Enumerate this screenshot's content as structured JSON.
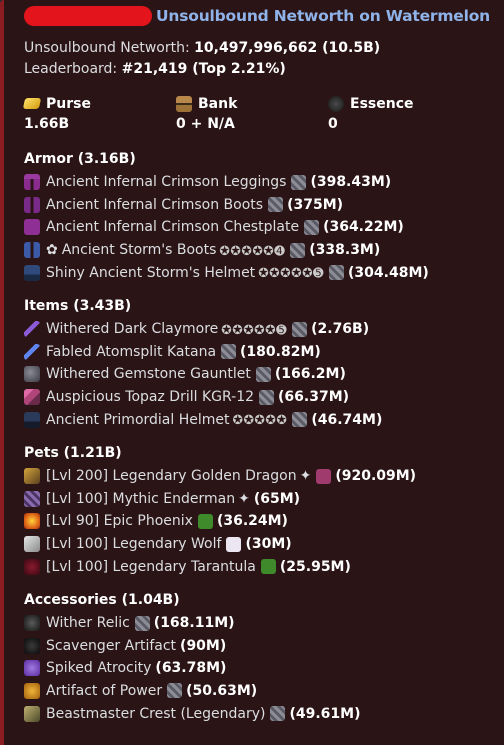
{
  "header": {
    "title": "Unsoulbound Networth on Watermelon"
  },
  "summary": {
    "networth_label": "Unsoulbound Networth:",
    "networth_value": "10,497,996,662 (10.5B)",
    "leaderboard_label": "Leaderboard:",
    "leaderboard_value": "#21,419 (Top 2.21%)"
  },
  "fields": [
    {
      "name": "Purse",
      "value": "1.66B",
      "icon": "gold-ingot-icon",
      "color": "#f5c518"
    },
    {
      "name": "Bank",
      "value": "0 + N/A",
      "icon": "chest-icon",
      "color": "#a07a44"
    },
    {
      "name": "Essence",
      "value": "0",
      "icon": "wither-essence-icon",
      "color": "#3a3a3a"
    }
  ],
  "sections": [
    {
      "title": "Armor (3.16B)",
      "items": [
        {
          "name": "Ancient Infernal Crimson Leggings",
          "value": "(398.43M)",
          "icon": "leggings-icon",
          "color": "#8a2b8f",
          "prefix": "",
          "stars": "",
          "glyph": ""
        },
        {
          "name": "Ancient Infernal Crimson Boots",
          "value": "(375M)",
          "icon": "boots-icon",
          "color": "#7a2a88",
          "prefix": "",
          "stars": "",
          "glyph": ""
        },
        {
          "name": "Ancient Infernal Crimson Chestplate",
          "value": "(364.22M)",
          "icon": "chestplate-icon",
          "color": "#8e2f96",
          "prefix": "",
          "stars": "",
          "glyph": ""
        },
        {
          "name": "Ancient Storm's Boots",
          "value": "(338.3M)",
          "icon": "storm-boots-icon",
          "color": "#3b5aa8",
          "prefix": "✿",
          "stars": "✪✪✪✪✪➍",
          "glyph": ""
        },
        {
          "name": "Shiny Ancient Storm's Helmet",
          "value": "(304.48M)",
          "icon": "storm-helmet-icon",
          "color": "#2f4a7a",
          "prefix": "",
          "stars": "✪✪✪✪✪➎",
          "glyph": ""
        }
      ]
    },
    {
      "title": "Items (3.43B)",
      "items": [
        {
          "name": "Withered Dark Claymore",
          "value": "(2.76B)",
          "icon": "claymore-icon",
          "color": "#6a3fb5",
          "prefix": "",
          "stars": "✪✪✪✪✪➎",
          "glyph": ""
        },
        {
          "name": "Fabled Atomsplit Katana",
          "value": "(180.82M)",
          "icon": "katana-icon",
          "color": "#4f6fd6",
          "prefix": "",
          "stars": "",
          "glyph": ""
        },
        {
          "name": "Withered Gemstone Gauntlet",
          "value": "(166.2M)",
          "icon": "gauntlet-icon",
          "color": "#5a5a66",
          "prefix": "",
          "stars": "",
          "glyph": ""
        },
        {
          "name": "Auspicious Topaz Drill KGR-12",
          "value": "(66.37M)",
          "icon": "drill-icon",
          "color": "#b0457a",
          "prefix": "",
          "stars": "",
          "glyph": ""
        },
        {
          "name": "Ancient Primordial Helmet",
          "value": "(46.74M)",
          "icon": "primordial-helmet-icon",
          "color": "#1f2a44",
          "prefix": "",
          "stars": "✪✪✪✪✪",
          "glyph": ""
        }
      ]
    },
    {
      "title": "Pets (1.21B)",
      "items": [
        {
          "name": "[Lvl 200] Legendary Golden Dragon",
          "value": "(920.09M)",
          "icon": "golden-dragon-icon",
          "color": "#8a6a2a",
          "prefix": "",
          "stars": "",
          "glyph": "✦",
          "held": "held-item-icon",
          "held_color": "#a03b6e"
        },
        {
          "name": "[Lvl 100] Mythic Enderman",
          "value": "(65M)",
          "icon": "enderman-icon",
          "color": "#6b4a8f",
          "prefix": "",
          "stars": "",
          "glyph": "✦"
        },
        {
          "name": "[Lvl 90] Epic Phoenix",
          "value": "(36.24M)",
          "icon": "phoenix-icon",
          "color": "#e07a18",
          "prefix": "",
          "stars": "",
          "glyph": "",
          "held": "held-item-icon",
          "held_color": "#3f8a2a"
        },
        {
          "name": "[Lvl 100] Legendary Wolf",
          "value": "(30M)",
          "icon": "wolf-icon",
          "color": "#bdbdbd",
          "prefix": "",
          "stars": "",
          "glyph": "",
          "held": "held-item-icon",
          "held_color": "#e6e0ec"
        },
        {
          "name": "[Lvl 100] Legendary Tarantula",
          "value": "(25.95M)",
          "icon": "tarantula-icon",
          "color": "#5a1020",
          "prefix": "",
          "stars": "",
          "glyph": "",
          "held": "held-item-icon",
          "held_color": "#3f8a2a"
        }
      ]
    },
    {
      "title": "Accessories (1.04B)",
      "items": [
        {
          "name": "Wither Relic",
          "value": "(168.11M)",
          "icon": "wither-relic-icon",
          "color": "#2a2a2a",
          "prefix": "",
          "stars": "",
          "glyph": ""
        },
        {
          "name": "Scavenger Artifact",
          "value": "(90M)",
          "icon": "scavenger-icon",
          "color": "#1a1a1a",
          "prefix": "",
          "stars": "",
          "glyph": ""
        },
        {
          "name": "Spiked Atrocity",
          "value": "(63.78M)",
          "icon": "spiked-atrocity-icon",
          "color": "#7a4ac8",
          "prefix": "",
          "stars": "",
          "glyph": ""
        },
        {
          "name": "Artifact of Power",
          "value": "(50.63M)",
          "icon": "artifact-power-icon",
          "color": "#d08a1c",
          "prefix": "",
          "stars": "",
          "glyph": ""
        },
        {
          "name": "Beastmaster Crest (Legendary)",
          "value": "(49.61M)",
          "icon": "beastmaster-crest-icon",
          "color": "#8a8a5a",
          "prefix": "",
          "stars": "",
          "glyph": ""
        }
      ]
    }
  ],
  "recomb_icon": {
    "name": "recombobulator-icon",
    "color": "#7c7c85"
  }
}
